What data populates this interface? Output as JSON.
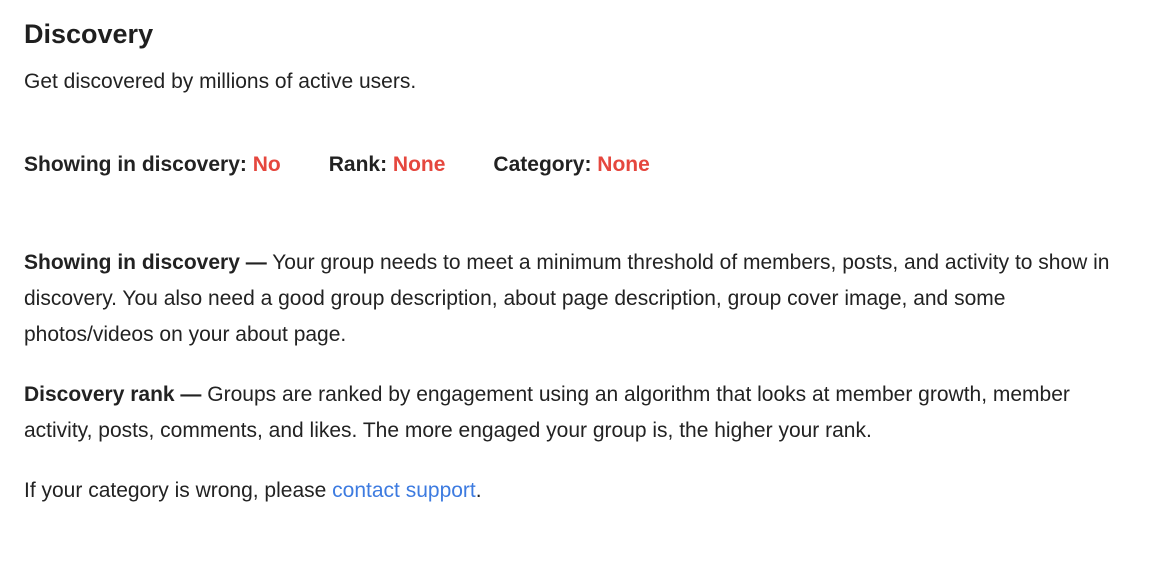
{
  "header": {
    "title": "Discovery",
    "subtitle": "Get discovered by millions of active users."
  },
  "status": {
    "showing_label": "Showing in discovery:",
    "showing_value": "No",
    "rank_label": "Rank:",
    "rank_value": "None",
    "category_label": "Category:",
    "category_value": "None",
    "value_color": "#e5473e"
  },
  "info": {
    "showing_heading": "Showing in discovery —",
    "showing_text": "Your group needs to meet a minimum threshold of members, posts, and activity to show in discovery. You also need a good group description, about page description, group cover image, and some photos/videos on your about page.",
    "rank_heading": "Discovery rank —",
    "rank_text": "Groups are ranked by engagement using an algorithm that looks at member growth, member activity, posts, comments, and likes. The more engaged your group is, the higher your rank.",
    "category_prefix": "If your category is wrong, please",
    "category_link": "contact support",
    "category_suffix": ".",
    "link_color": "#3d7be0"
  }
}
